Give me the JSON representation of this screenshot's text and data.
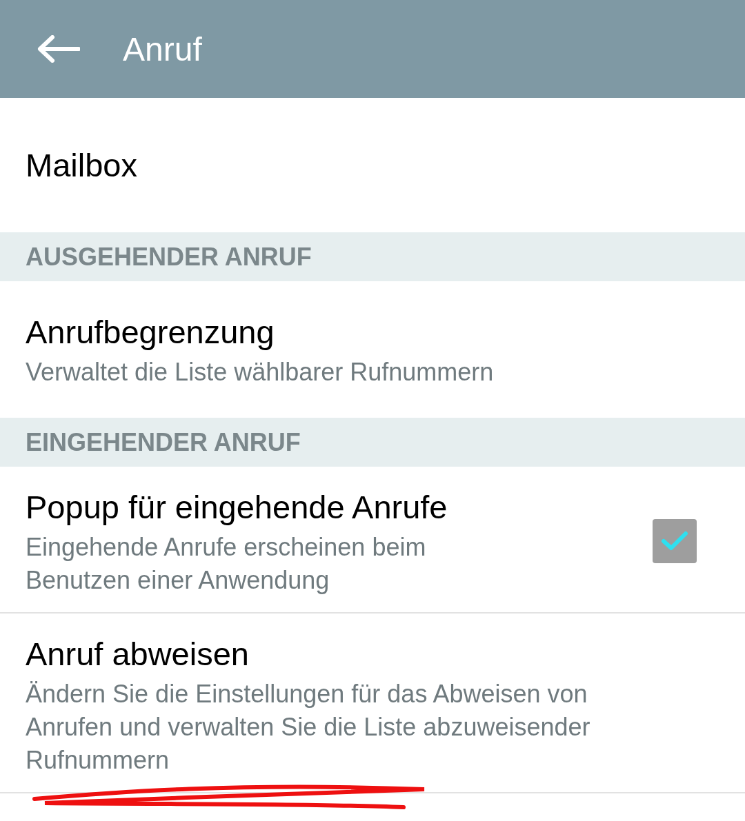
{
  "header": {
    "title": "Anruf"
  },
  "items": [
    {
      "kind": "item",
      "title": "Mailbox"
    },
    {
      "kind": "section",
      "title": "AUSGEHENDER ANRUF"
    },
    {
      "kind": "item",
      "title": "Anrufbegrenzung",
      "subtitle": "Verwaltet die Liste wählbarer Rufnummern"
    },
    {
      "kind": "section",
      "title": "EINGEHENDER ANRUF"
    },
    {
      "kind": "check",
      "title": "Popup für eingehende Anrufe",
      "subtitle": "Eingehende Anrufe erscheinen beim Benutzen einer Anwendung",
      "checked": true
    },
    {
      "kind": "item",
      "title": "Anruf abweisen",
      "subtitle": "Ändern Sie die Einstellungen für das Abweisen von Anrufen und verwalten Sie die Liste abzuweisender Rufnummern"
    }
  ]
}
